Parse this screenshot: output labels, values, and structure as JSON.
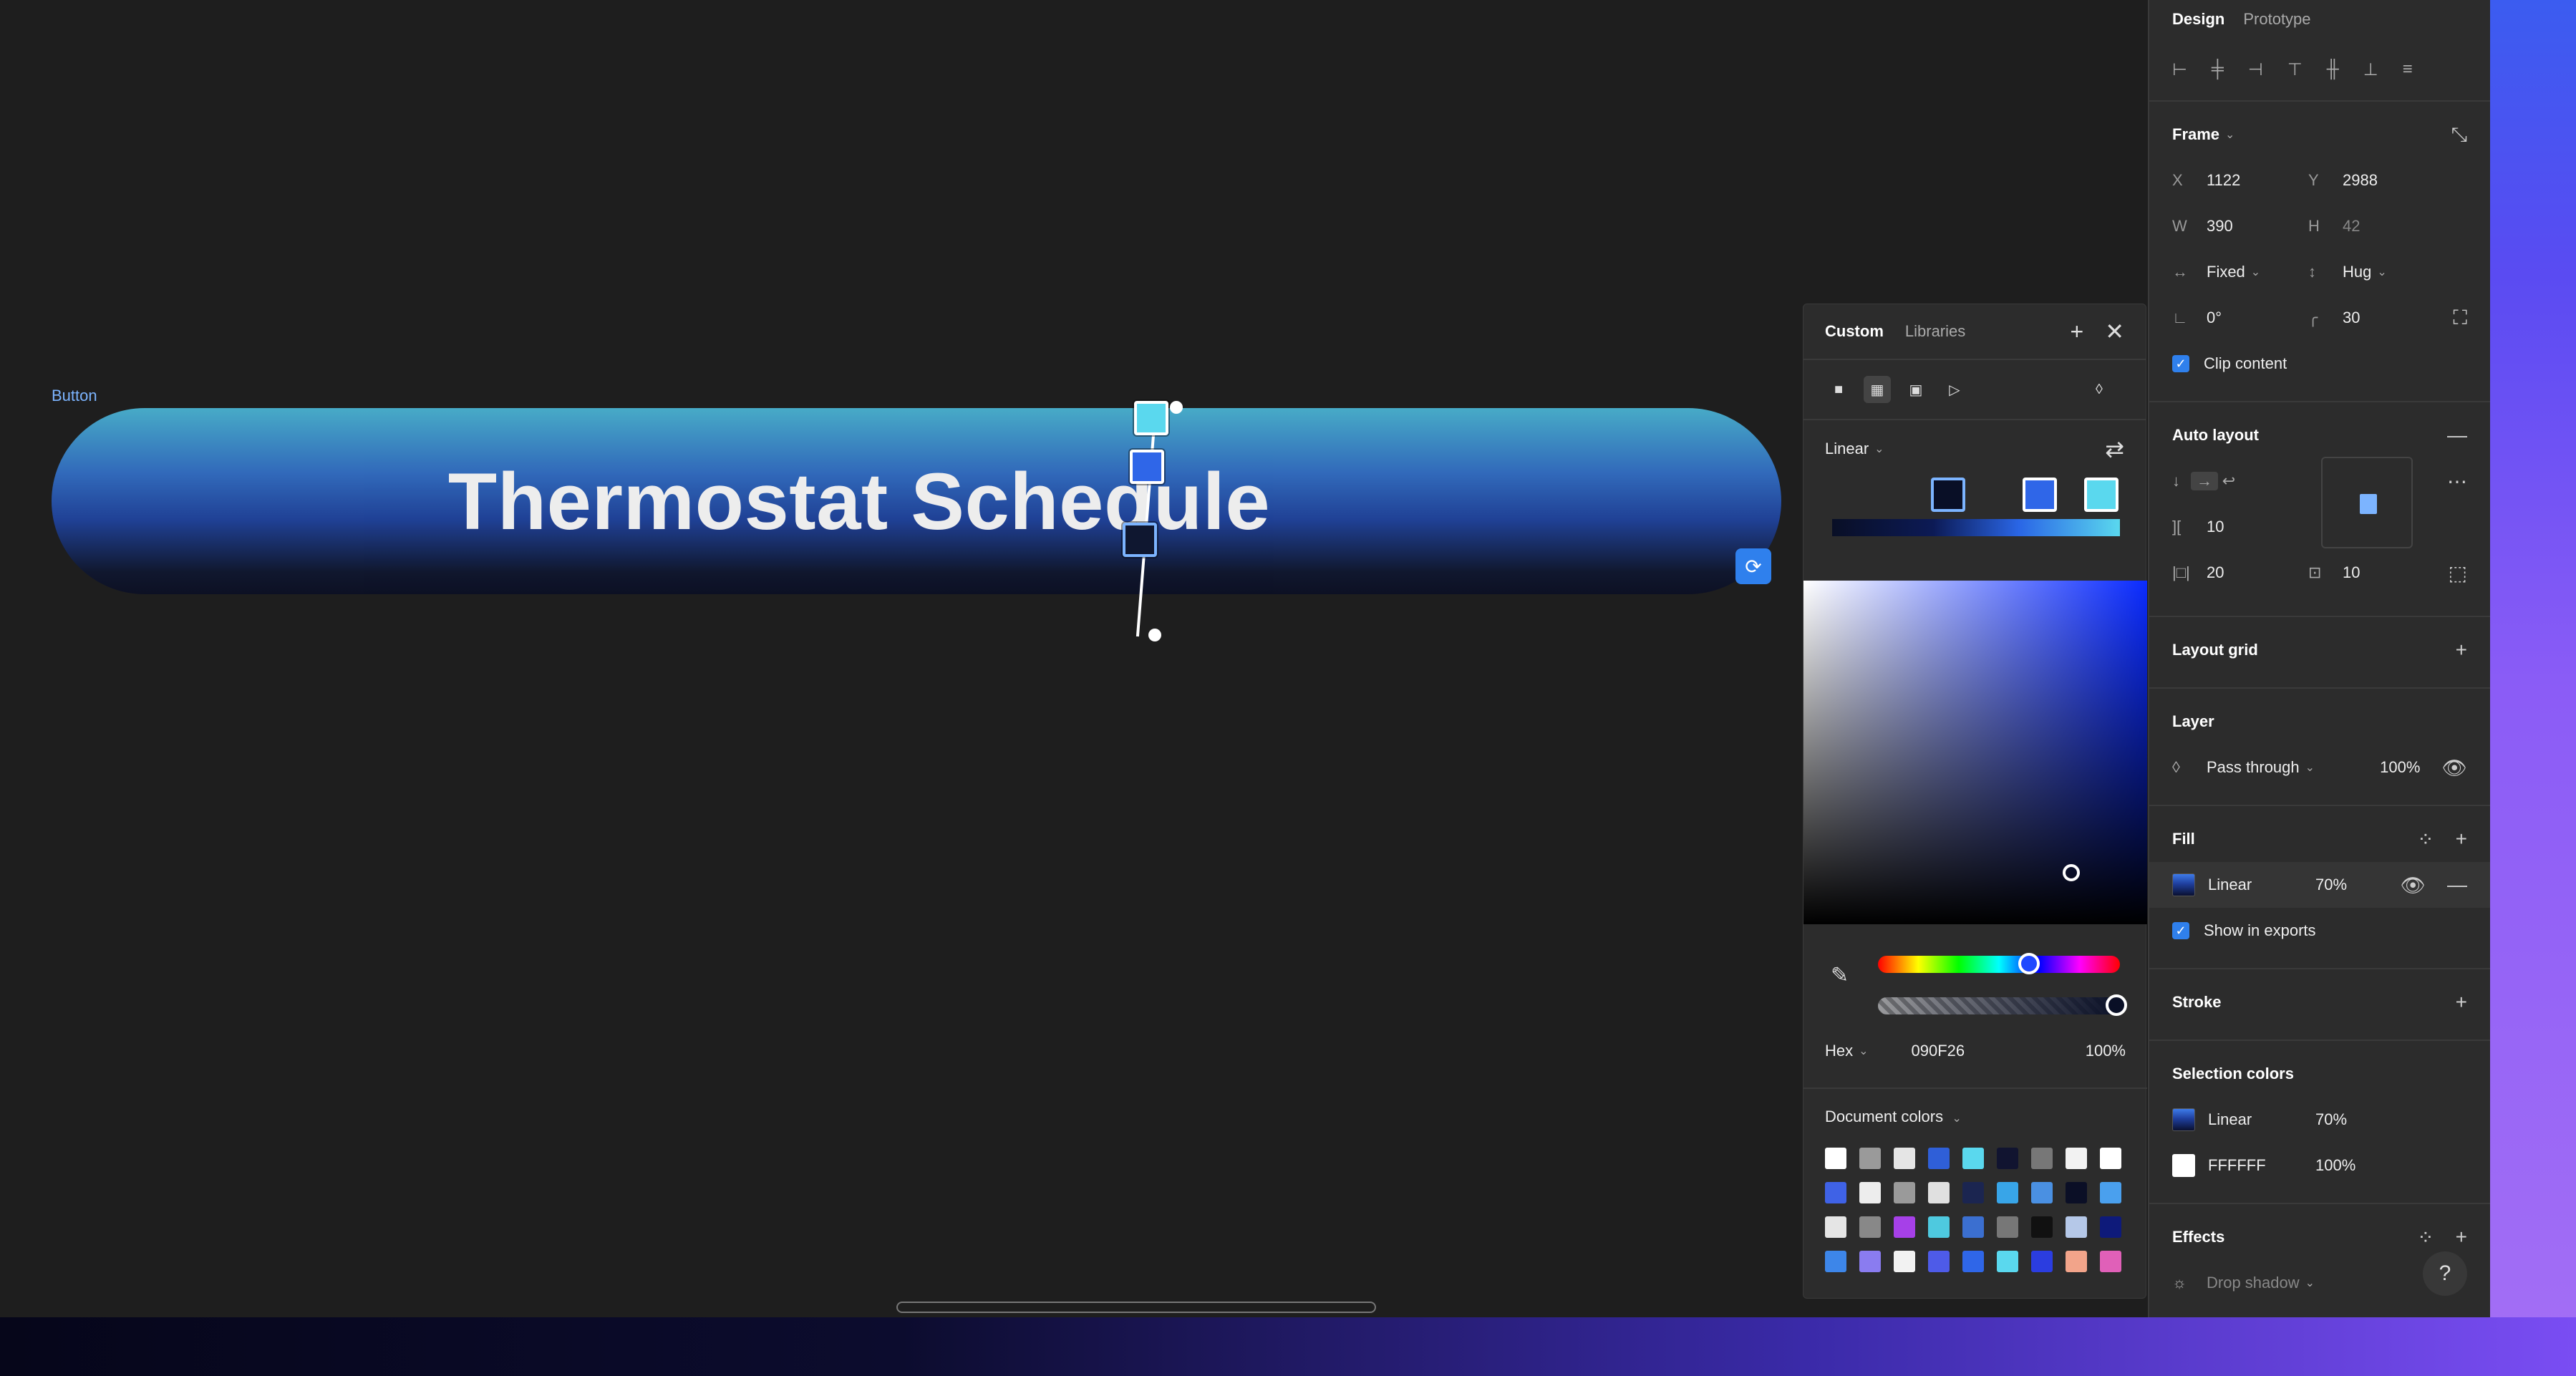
{
  "canvas": {
    "frame_label": "Button",
    "button_text": "Thermostat Schedule"
  },
  "picker": {
    "tabs": [
      "Custom",
      "Libraries"
    ],
    "gradient_type": "Linear",
    "color_model": "Hex",
    "hex_value": "090F26",
    "opacity": "100%",
    "document_colors_label": "Document colors",
    "swatches": [
      "#ffffff",
      "#9a9a9a",
      "#e5e5e5",
      "#2f5fd8",
      "#5ad8ee",
      "#111430",
      "#777777",
      "#f2f2f2",
      "#ffffff",
      "#3f62e6",
      "#ededed",
      "#9a9a9a",
      "#e0e0e0",
      "#1b2550",
      "#38a5e8",
      "#4a90e2",
      "#0b0f26",
      "#4aa0ee",
      "#e5e5e5",
      "#888888",
      "#a640e8",
      "#4ec9df",
      "#3b6fd0",
      "#777777",
      "#111111",
      "#b5c8e8",
      "#0e1a7a",
      "#3d86e9",
      "#8a7cf0",
      "#f2f2f2",
      "#4e5be8",
      "#2f66e8",
      "#5ad8ee",
      "#2b3de0",
      "#f2a48a",
      "#e060b8"
    ]
  },
  "props": {
    "tabs": [
      "Design",
      "Prototype"
    ],
    "frame": {
      "title": "Frame",
      "x_label": "X",
      "x": "1122",
      "y_label": "Y",
      "y": "2988",
      "w_label": "W",
      "w": "390",
      "h_label": "H",
      "h": "42",
      "h_sizing": "Fixed",
      "v_sizing": "Hug",
      "rotation": "0°",
      "radius": "30",
      "clip_content": "Clip content"
    },
    "auto_layout": {
      "title": "Auto layout",
      "gap": "10",
      "padding_h": "20",
      "padding_v": "10"
    },
    "layout_grid": {
      "title": "Layout grid"
    },
    "layer": {
      "title": "Layer",
      "blend": "Pass through",
      "opacity": "100%"
    },
    "fill": {
      "title": "Fill",
      "type": "Linear",
      "opacity": "70%",
      "show_in_exports": "Show in exports"
    },
    "stroke": {
      "title": "Stroke"
    },
    "selection_colors": {
      "title": "Selection colors",
      "items": [
        {
          "name": "Linear",
          "opacity": "70%"
        },
        {
          "name": "FFFFFF",
          "opacity": "100%"
        }
      ]
    },
    "effects": {
      "title": "Effects",
      "item": "Drop shadow"
    }
  },
  "help_label": "?"
}
